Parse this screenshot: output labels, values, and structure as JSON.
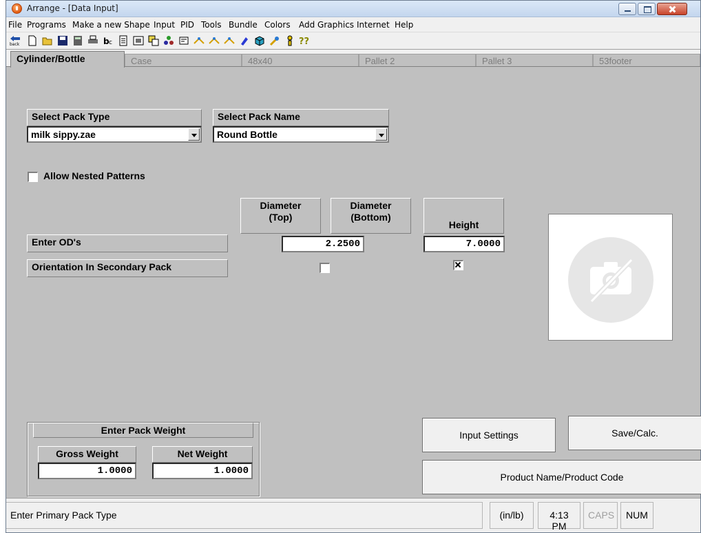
{
  "window": {
    "title": "Arrange - [Data Input]"
  },
  "menu": [
    "File",
    "Programs",
    "Make a new Shape",
    "Input",
    "PID",
    "Tools",
    "Bundle",
    "Colors",
    "Add Graphics",
    "Internet",
    "Help"
  ],
  "toolbar": {
    "back_label": "back",
    "icons": [
      "back-icon",
      "new-file-icon",
      "open-folder-icon",
      "save-icon",
      "calculator-icon",
      "print-icon",
      "text-style-icon",
      "document-icon",
      "preview-icon",
      "copy-icon",
      "tree-icon",
      "settings-icon",
      "pattern-icon",
      "pattern-icon",
      "pattern-icon",
      "paint-icon",
      "box-icon",
      "tool-icon",
      "figure-icon",
      "help-icon"
    ],
    "help_text": "??"
  },
  "tabs": [
    "Cylinder/Bottle",
    "Case",
    "48x40",
    "Pallet 2",
    "Pallet 3",
    "53footer"
  ],
  "form": {
    "pack_type_label": "Select Pack Type",
    "pack_type_value": "milk sippy.zae",
    "pack_name_label": "Select Pack Name",
    "pack_name_value": "Round Bottle",
    "allow_nested_label": "Allow Nested Patterns",
    "allow_nested_checked": false,
    "col_diameter_top_1": "Diameter",
    "col_diameter_top_2": "(Top)",
    "col_diameter_bottom_1": "Diameter",
    "col_diameter_bottom_2": "(Bottom)",
    "col_height": "Height",
    "enter_od_label": "Enter OD's",
    "diameter_value": "2.2500",
    "height_value": "7.0000",
    "orientation_label": "Orientation In Secondary Pack",
    "orientation_diameter_checked": false,
    "orientation_height_checked": true
  },
  "weight": {
    "group_label": "Enter Pack Weight",
    "gross_label": "Gross Weight",
    "gross_value": "1.0000",
    "net_label": "Net Weight",
    "net_value": "1.0000"
  },
  "buttons": {
    "input_settings": "Input Settings",
    "save_calc": "Save/Calc.",
    "product_name": "Product Name/Product Code"
  },
  "status": {
    "message": "Enter Primary Pack Type",
    "units": "(in/lb)",
    "time": "4:13 PM",
    "caps": "CAPS",
    "num": "NUM"
  },
  "colors": {
    "panel": "#c0c0c0",
    "chrome": "#f0f0f0",
    "close_button": "#c8432a"
  }
}
